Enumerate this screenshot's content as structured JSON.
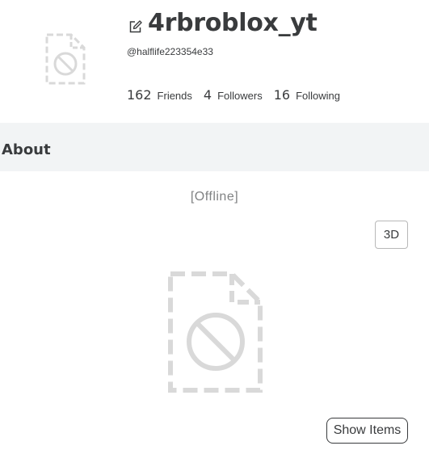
{
  "profile": {
    "username": "4rbroblox_yt",
    "handle": "@halflife223354e33",
    "edit_icon": "edit-icon",
    "avatar_icon": "broken-image-icon"
  },
  "stats": [
    {
      "count": "162",
      "label": "Friends"
    },
    {
      "count": "4",
      "label": "Followers"
    },
    {
      "count": "16",
      "label": "Following"
    }
  ],
  "about": {
    "title": "About"
  },
  "avatar_section": {
    "status": "[Offline]",
    "view_toggle_label": "3D",
    "show_items_label": "Show Items",
    "avatar_icon": "broken-image-icon"
  },
  "colors": {
    "text": "#393b3d",
    "muted_text": "#808283",
    "section_bg": "#f2f4f5",
    "placeholder": "#d9d9d9"
  }
}
